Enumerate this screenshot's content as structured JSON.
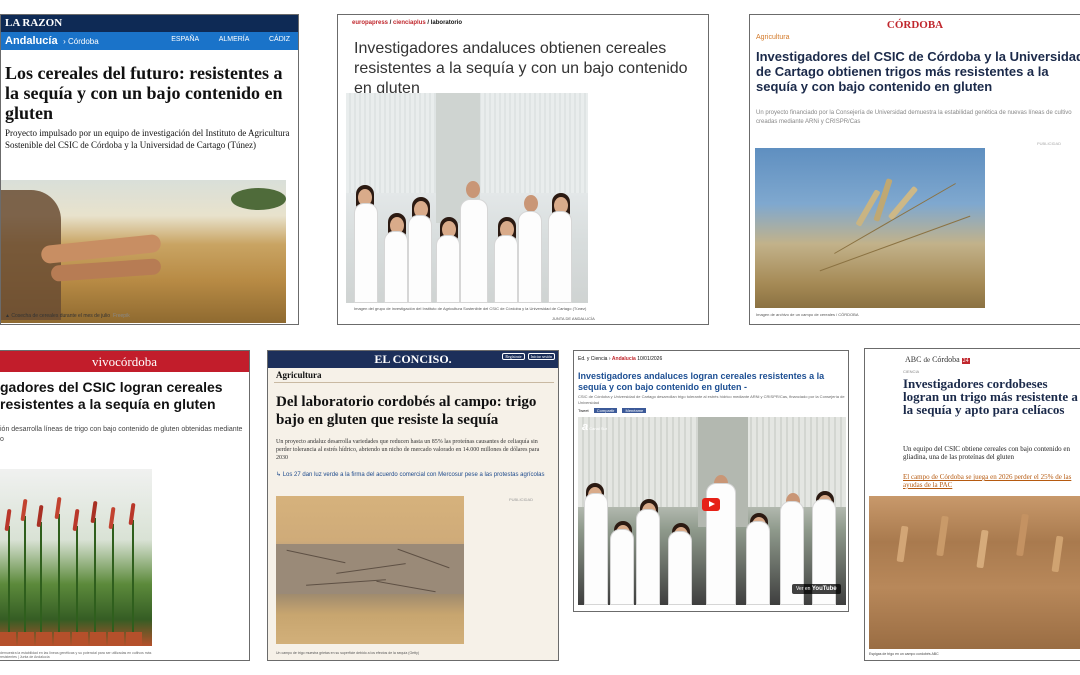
{
  "clips": {
    "larazon": {
      "brand": "LA RAZON",
      "nav_region": "Andalucía",
      "nav_sub": "Córdoba",
      "nav_links": [
        "ESPAÑA",
        "ALMERÍA",
        "CÁDIZ"
      ],
      "headline": "Los cereales del futuro: resistentes a la sequía y con un bajo contenido en gluten",
      "lede": "Proyecto impulsado por un equipo de investigación del Instituto de Agricultura Sostenible del CSIC de Córdoba y la Universidad de Cartago (Túnez)",
      "caption": "Cosecha de cereales durante el mes de julio",
      "caption_credit": "Freepik"
    },
    "europapress": {
      "crumb": [
        "europapress",
        "cienciaplus",
        "laboratorio"
      ],
      "headline": "Investigadores andaluces obtienen cereales resistentes a la sequía y con un bajo contenido en gluten",
      "caption": "Imagen del grupo de investigación del Instituto de Agricultura Sostenible del CSIC de Córdoba y la Universidad de Cartago (Túnez)",
      "credit": "JUNTA DE ANDALUCÍA"
    },
    "cordoba": {
      "brand": "CÓRDOBA",
      "section": "Agricultura",
      "headline": "Investigadores del CSIC de Córdoba y la Universidad de Cartago obtienen trigos más resistentes a la sequía y con bajo contenido en gluten",
      "lede": "Un proyecto financiado por la Consejería de Universidad demuestra la estabilidad genética de nuevas líneas de cultivo creadas mediante ARNi y CRISPR/Cas",
      "pub": "PUBLICIDAD",
      "caption": "Imagen de archivo de un campo de cereales / CÓRDOBA"
    },
    "vivocordoba": {
      "brand": "vivocórdoba",
      "headline": "gadores del CSIC logran cereales resistentes a la sequía en gluten",
      "lede": "ión desarrolla líneas de trigo con bajo contenido de gluten obtenidas mediante o",
      "caption": "demuestra la estabilidad en las líneas genéticas y su potencial para ser utilizadas en cultivos más resistentes | Junta de Andalucía"
    },
    "confidencial": {
      "brand": "EL CONCISO.",
      "btns": [
        "Regístrate",
        "Iniciar sesión"
      ],
      "section": "Agricultura",
      "headline": "Del laboratorio cordobés al campo: trigo bajo en gluten que resiste la sequía",
      "lede": "Un proyecto andaluz desarrolla variedades que reducen hasta un 85% las proteínas causantes de celiaquía sin perder tolerancia al estrés hídrico, abriendo un nicho de mercado valorado en 14.000 millones de dólares para 2030",
      "related": "Los 27 dan luz verde a la firma del acuerdo comercial con Mercosur pese a las protestas agrícolas",
      "pub": "PUBLICIDAD",
      "caption": "Un campo de trigo muestra grietas en su superficie debido a los efectos de la sequía (Getty)"
    },
    "video": {
      "crumb_start": "Ed. y Ciencia",
      "crumb_red": "Andalucía",
      "crumb_date": "10/01/2026",
      "headline": "Investigadores andaluces logran cereales resistentes a la sequía y con bajo contenido en gluten -",
      "lede": "CSIC de Córdoba y Universidad de Cartago desarrollan trigo tolerante al estrés hídrico mediante ARNi y CRISPR/Cas, financiado por la Consejería de Universidad",
      "share": [
        "Tweet",
        "Compartir",
        "Menéame"
      ],
      "channel": "a",
      "channel_name": "Canal Sur",
      "yt_label": "Ver en",
      "yt_brand": "YouTube"
    },
    "abc": {
      "brand": "ABC",
      "brand_city": "Córdoba",
      "brand_badge": "24",
      "section": "CIENCIA",
      "headline": "Investigadores cordobeses logran un trigo más resistente a la sequía y apto para celíacos",
      "lede": "Un equipo del CSIC obtiene cereales con bajo contenido en gliadina, una de las proteínas del gluten",
      "related": "El campo de Córdoba se juega en 2026 perder el 25% de las ayudas de la PAC",
      "caption": "Espigas de trigo en un campo cordobés ABC"
    }
  },
  "colors": {
    "larazon_nav": "#1a73c9",
    "vivo_red": "#c21d2b",
    "confidencial_navy": "#1c2f5a",
    "cordoba_red": "#c0272d",
    "abc_related": "#b65a10"
  }
}
